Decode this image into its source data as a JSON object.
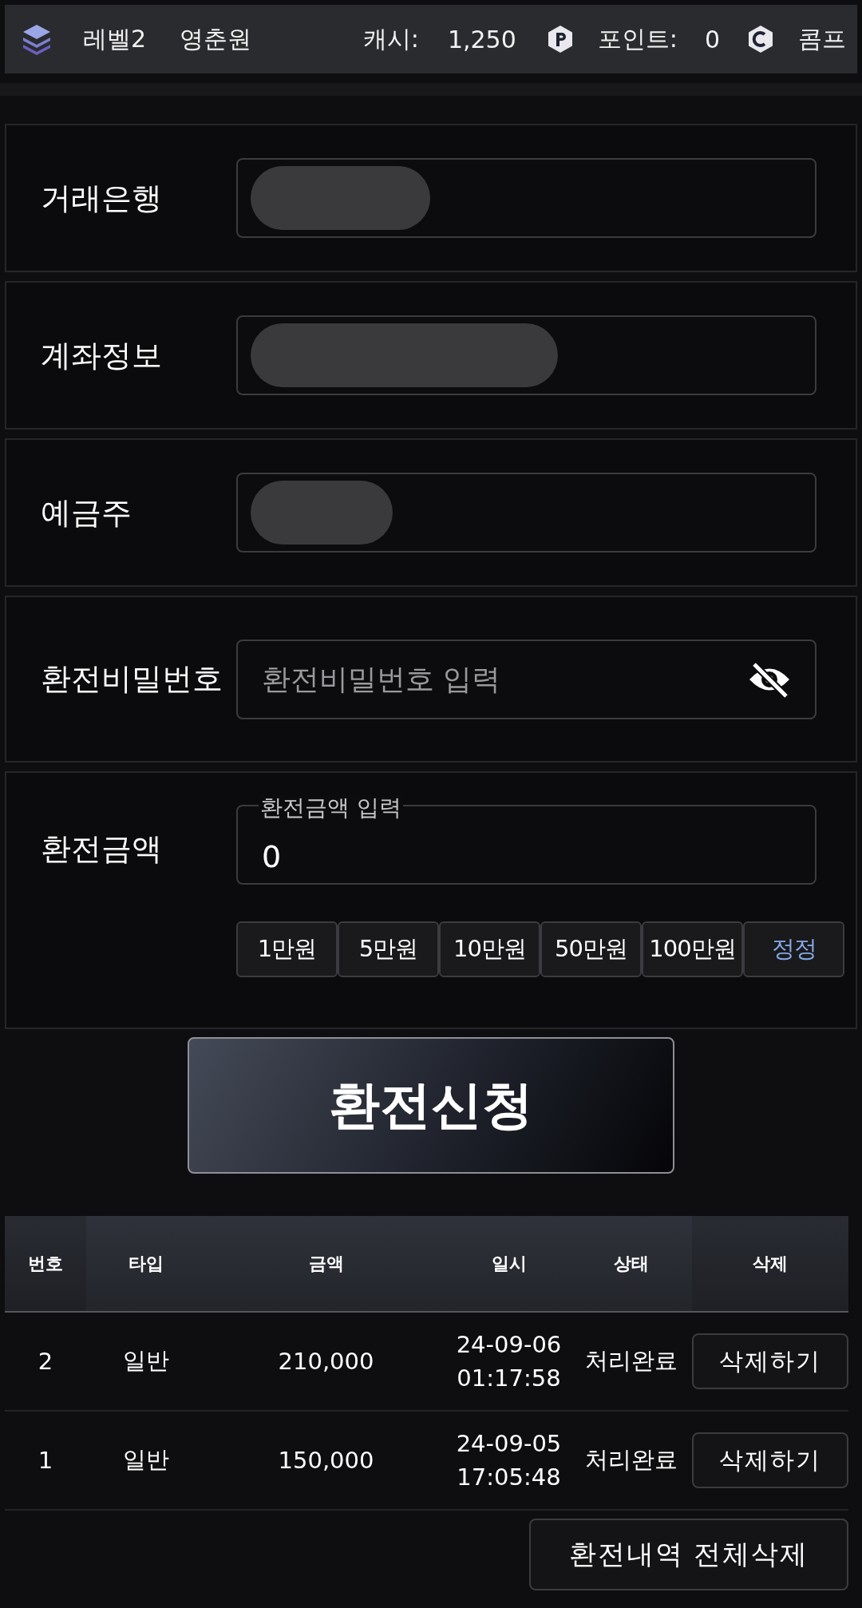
{
  "top_bar": {
    "level": "레벨2",
    "username": "영춘원",
    "cash_label": "캐시:",
    "cash": "1,250",
    "point_label": "포인트:",
    "points": "0",
    "comp_label": "콤프"
  },
  "form": [
    {
      "kind": "redacted",
      "label": "거래은행"
    },
    {
      "kind": "redacted",
      "label": "계좌정보"
    },
    {
      "kind": "redacted",
      "label": "예금주"
    },
    {
      "kind": "password",
      "label": "환전비밀번호",
      "placeholder": "환전비밀번호 입력"
    },
    {
      "kind": "amount",
      "label": "환전금액",
      "floating_label": "환전금액 입력",
      "value": "0"
    }
  ],
  "amount_buttons": [
    {
      "label": "1만원",
      "kind": "add"
    },
    {
      "label": "5만원",
      "kind": "add"
    },
    {
      "label": "10만원",
      "kind": "add"
    },
    {
      "label": "50만원",
      "kind": "add"
    },
    {
      "label": "100만원",
      "kind": "add"
    },
    {
      "label": "정정",
      "kind": "reset"
    }
  ],
  "submit_button": "환전신청",
  "history": {
    "columns": [
      "번호",
      "타입",
      "금액",
      "일시",
      "상태",
      "삭제"
    ],
    "rows": [
      {
        "number": "2",
        "type": "일반",
        "amount": "210,000",
        "datetime": [
          "24-09-06",
          "01:17:58"
        ],
        "status": "처리완료",
        "action": "삭제하기"
      },
      {
        "number": "1",
        "type": "일반",
        "amount": "150,000",
        "datetime": [
          "24-09-05",
          "17:05:48"
        ],
        "status": "처리완료",
        "action": "삭제하기"
      }
    ]
  },
  "delete_all_button": "환전내역 전체삭제"
}
